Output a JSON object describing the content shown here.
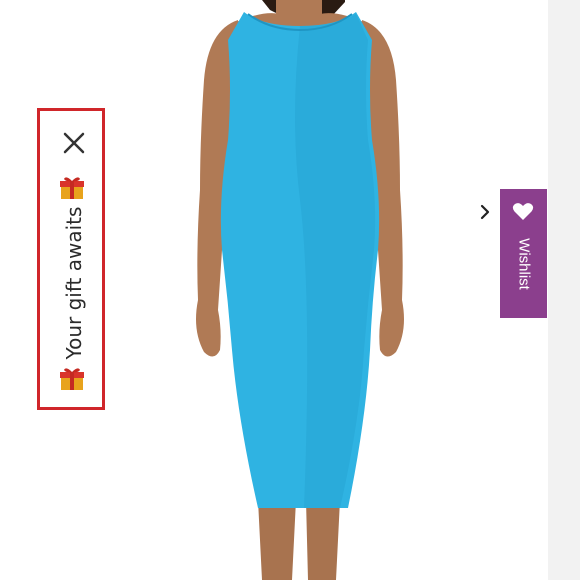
{
  "gift_widget": {
    "label": "Your gift awaits",
    "gift_emoji": "gift-box-icon",
    "close_icon": "close-icon",
    "border_color": "#d0262a"
  },
  "wishlist": {
    "label": "Wishlist",
    "icon": "heart-icon",
    "toggle_icon": "chevron-right-icon",
    "color": "#8b3f8d"
  },
  "product_image": {
    "dress_color": "#2fb3e2"
  }
}
